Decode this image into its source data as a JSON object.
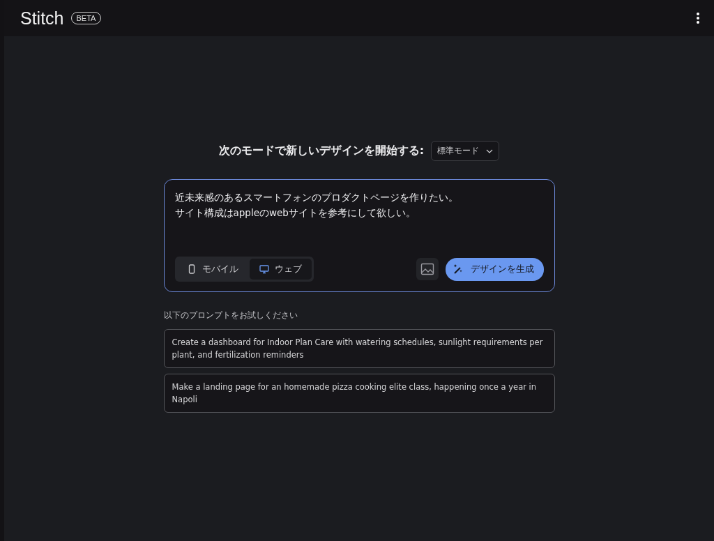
{
  "header": {
    "title": "Stitch",
    "badge": "BETA"
  },
  "heading": {
    "text": "次のモードで新しいデザインを開始する:",
    "mode_select": "標準モード"
  },
  "prompt": {
    "lines": [
      "近未来感のあるスマートフォンのプロダクトページを作りたい。",
      "サイト構成はappleのwebサイトを参考にして欲しい。"
    ],
    "platforms": [
      {
        "label": "モバイル",
        "kind": "mobile",
        "selected": false
      },
      {
        "label": "ウェブ",
        "kind": "web",
        "selected": true
      }
    ],
    "generate_button": "デザインを生成"
  },
  "suggestions": {
    "title": "以下のプロンプトをお試しください",
    "items": [
      "Create a dashboard for Indoor Plan Care with watering schedules, sunlight requirements per plant, and fertilization reminders",
      "Make a landing page for an homemade pizza cooking elite class, happening once a year in Napoli"
    ]
  }
}
